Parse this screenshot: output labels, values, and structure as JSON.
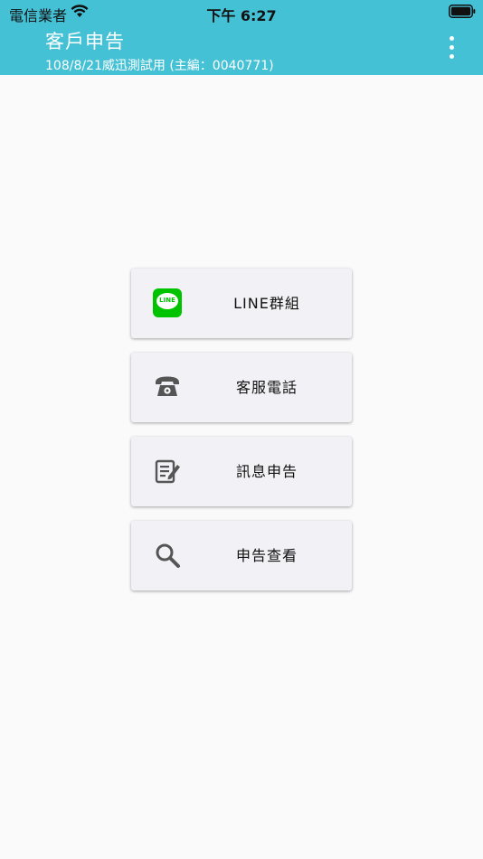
{
  "status_bar": {
    "carrier": "電信業者",
    "time": "下午 6:27"
  },
  "header": {
    "title": "客戶申告",
    "subtitle": "108/8/21威迅測試用 (主編：0040771)"
  },
  "buttons": [
    {
      "label": "LINE群組",
      "icon": "line-icon",
      "badge": "LINE"
    },
    {
      "label": "客服電話",
      "icon": "phone-icon"
    },
    {
      "label": "訊息申告",
      "icon": "edit-note-icon"
    },
    {
      "label": "申告查看",
      "icon": "search-icon"
    }
  ],
  "colors": {
    "header_bg": "#45c1d6",
    "page_bg": "#fafafa",
    "card_bg": "#f2f2f6",
    "line_green": "#00c300",
    "icon_gray": "#555555"
  }
}
